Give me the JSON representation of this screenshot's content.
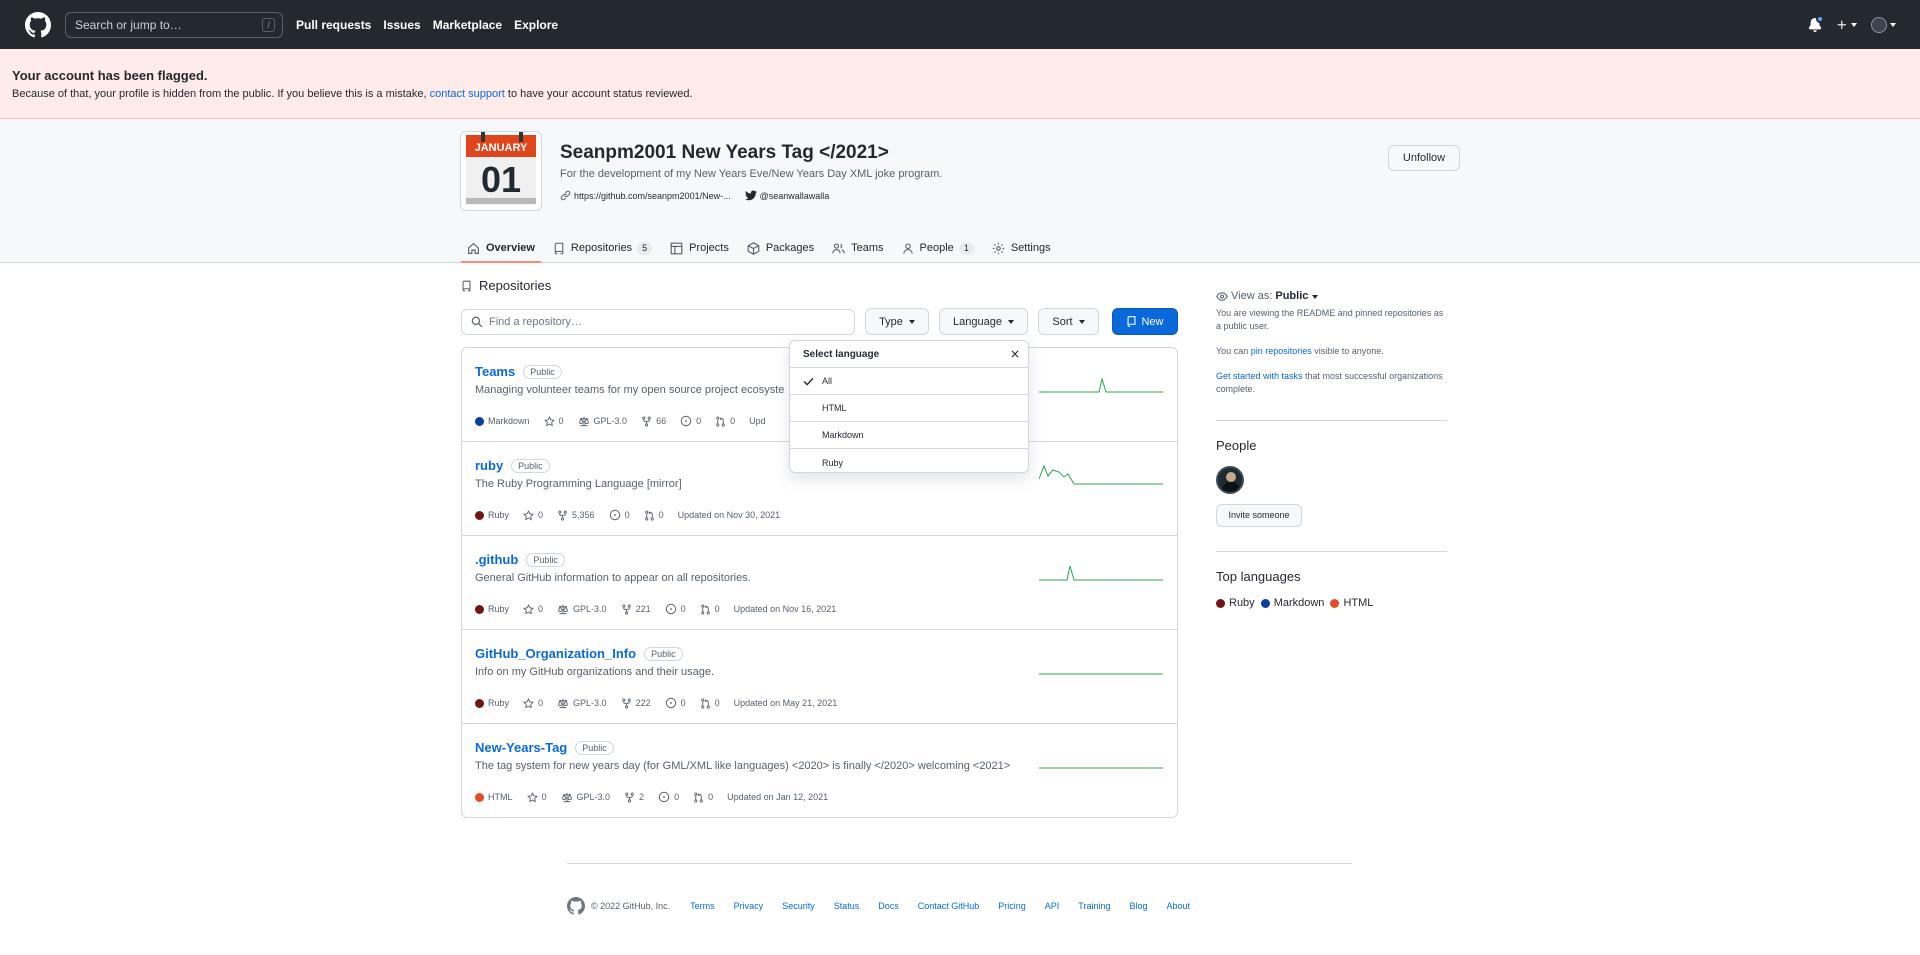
{
  "header": {
    "search_placeholder": "Search or jump to…",
    "slash_key": "/",
    "nav": [
      "Pull requests",
      "Issues",
      "Marketplace",
      "Explore"
    ]
  },
  "flash": {
    "title": "Your account has been flagged.",
    "text_before": "Because of that, your profile is hidden from the public. If you believe this is a mistake, ",
    "link": "contact support",
    "text_after": " to have your account status reviewed."
  },
  "org": {
    "avatar_month": "JANUARY",
    "avatar_day": "01",
    "name": "Seanpm2001 New Years Tag </2021>",
    "description": "For the development of my New Years Eve/New Years Day XML joke program.",
    "website": "https://github.com/seanpm2001/New-...",
    "twitter": "@seanwallawalla",
    "unfollow_label": "Unfollow",
    "tabs": [
      {
        "label": "Overview",
        "count": ""
      },
      {
        "label": "Repositories",
        "count": "5"
      },
      {
        "label": "Projects",
        "count": ""
      },
      {
        "label": "Packages",
        "count": ""
      },
      {
        "label": "Teams",
        "count": ""
      },
      {
        "label": "People",
        "count": "1"
      },
      {
        "label": "Settings",
        "count": ""
      }
    ]
  },
  "repos": {
    "title": "Repositories",
    "find_placeholder": "Find a repository…",
    "type_label": "Type",
    "language_label": "Language",
    "sort_label": "Sort",
    "new_label": "New",
    "items": [
      {
        "name": "Teams",
        "visibility": "Public",
        "description": "Managing volunteer teams for my open source project ecosyste",
        "language": "Markdown",
        "stars": "0",
        "license": "GPL-3.0",
        "forks": "66",
        "issues": "0",
        "prs": "0",
        "updated": "Upd"
      },
      {
        "name": "ruby",
        "visibility": "Public",
        "description": "The Ruby Programming Language [mirror]",
        "language": "Ruby",
        "stars": "0",
        "license": "",
        "forks": "5,356",
        "issues": "0",
        "prs": "0",
        "updated": "Updated on Nov 30, 2021"
      },
      {
        "name": ".github",
        "visibility": "Public",
        "description": "General GitHub information to appear on all repositories.",
        "language": "Ruby",
        "stars": "0",
        "license": "GPL-3.0",
        "forks": "221",
        "issues": "0",
        "prs": "0",
        "updated": "Updated on Nov 16, 2021"
      },
      {
        "name": "GitHub_Organization_Info",
        "visibility": "Public",
        "description": "Info on my GitHub organizations and their usage.",
        "language": "Ruby",
        "stars": "0",
        "license": "GPL-3.0",
        "forks": "222",
        "issues": "0",
        "prs": "0",
        "updated": "Updated on May 21, 2021"
      },
      {
        "name": "New-Years-Tag",
        "visibility": "Public",
        "description": "The tag system for new years day (for GML/XML like languages) <2020> is finally </2020> welcoming <2021>",
        "language": "HTML",
        "stars": "0",
        "license": "GPL-3.0",
        "forks": "2",
        "issues": "0",
        "prs": "0",
        "updated": "Updated on Jan 12, 2021"
      }
    ]
  },
  "language_dropdown": {
    "title": "Select language",
    "options": [
      "All",
      "HTML",
      "Markdown",
      "Ruby"
    ],
    "selected": "All"
  },
  "sidebar": {
    "view_as_label": "View as:",
    "view_as_value": "Public",
    "view_as_text": "You are viewing the README and pinned repositories as a public user.",
    "pin_before": "You can ",
    "pin_link": "pin repositories",
    "pin_after": " visible to anyone.",
    "tasks_link": "Get started with tasks",
    "tasks_after": " that most successful organizations complete.",
    "people_title": "People",
    "invite_label": "Invite someone",
    "languages_title": "Top languages",
    "top_languages": [
      "Ruby",
      "Markdown",
      "HTML"
    ]
  },
  "colors": {
    "Ruby": "#701516",
    "Markdown": "#083fa1",
    "HTML": "#e34c26",
    "accent": "#0969da",
    "spark": "#2da44e"
  },
  "footer": {
    "copyright": "© 2022 GitHub, Inc.",
    "links": [
      "Terms",
      "Privacy",
      "Security",
      "Status",
      "Docs",
      "Contact GitHub",
      "Pricing",
      "API",
      "Training",
      "Blog",
      "About"
    ]
  }
}
